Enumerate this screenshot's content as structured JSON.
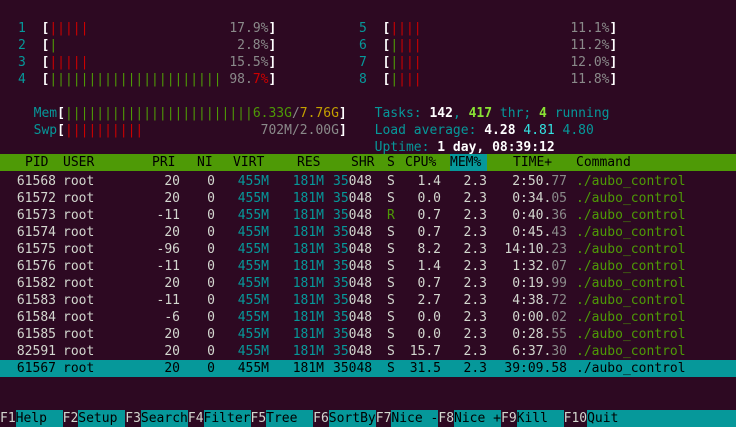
{
  "cpus": [
    {
      "num": "1",
      "bars_green": "",
      "bars_red": "|||||",
      "pct": "17.9%"
    },
    {
      "num": "2",
      "bars_green": "|",
      "bars_red": "",
      "pct": "2.8%"
    },
    {
      "num": "3",
      "bars_green": "",
      "bars_red": "|||||",
      "pct": "15.5%"
    },
    {
      "num": "4",
      "bars_green": "||||||||||||||||||||||",
      "bars_red": "",
      "pct_lead": "98.",
      "pct_tail": "7%"
    },
    {
      "num": "5",
      "bars_green": "",
      "bars_red": "||||",
      "pct": "11.1%"
    },
    {
      "num": "6",
      "bars_green": "|",
      "bars_red": "|||",
      "pct": "11.2%"
    },
    {
      "num": "7",
      "bars_green": "|",
      "bars_red": "|||",
      "pct": "12.0%"
    },
    {
      "num": "8",
      "bars_green": "|",
      "bars_red": "|||",
      "pct": "11.8%"
    }
  ],
  "mem": {
    "label": "Mem",
    "bars": "||||||||||||||||||||||||",
    "used": "6.33G",
    "sep": "/",
    "total": "7.76G"
  },
  "swp": {
    "label": "Swp",
    "bars": "||||||||||",
    "value": "702M/2.00G"
  },
  "tasks": {
    "label": "Tasks: ",
    "count": "142",
    "sep1": ", ",
    "thr": "417",
    "thr_label": " thr; ",
    "running": "4",
    "running_label": " running"
  },
  "load": {
    "label": "Load average: ",
    "l1": "4.28",
    "l5": "4.81",
    "l15": "4.80"
  },
  "uptime": {
    "label": "Uptime: ",
    "value": "1 day, 08:39:12"
  },
  "columns": {
    "pid": "PID",
    "user": "USER",
    "pri": "PRI",
    "ni": "NI",
    "virt": "VIRT",
    "res": "RES",
    "shr": "SHR",
    "s": "S",
    "cpu": "CPU%",
    "mem": "MEM%",
    "time": "TIME+",
    "command": "Command"
  },
  "processes": [
    {
      "pid": "61568",
      "user": "root",
      "pri": "20",
      "ni": "0",
      "virt": "455M",
      "res": "181M",
      "shr_a": "35",
      "shr_b": "048",
      "s": "S",
      "cpu": "1.4",
      "mem": "2.3",
      "time_a": "2:50.",
      "time_b": "77",
      "command": "./aubo_control"
    },
    {
      "pid": "61572",
      "user": "root",
      "pri": "20",
      "ni": "0",
      "virt": "455M",
      "res": "181M",
      "shr_a": "35",
      "shr_b": "048",
      "s": "S",
      "cpu": "0.0",
      "mem": "2.3",
      "time_a": "0:34.",
      "time_b": "05",
      "command": "./aubo_control"
    },
    {
      "pid": "61573",
      "user": "root",
      "pri": "-11",
      "ni": "0",
      "virt": "455M",
      "res": "181M",
      "shr_a": "35",
      "shr_b": "048",
      "s": "R",
      "cpu": "0.7",
      "mem": "2.3",
      "time_a": "0:40.",
      "time_b": "36",
      "command": "./aubo_control"
    },
    {
      "pid": "61574",
      "user": "root",
      "pri": "20",
      "ni": "0",
      "virt": "455M",
      "res": "181M",
      "shr_a": "35",
      "shr_b": "048",
      "s": "S",
      "cpu": "0.7",
      "mem": "2.3",
      "time_a": "0:45.",
      "time_b": "43",
      "command": "./aubo_control"
    },
    {
      "pid": "61575",
      "user": "root",
      "pri": "-96",
      "ni": "0",
      "virt": "455M",
      "res": "181M",
      "shr_a": "35",
      "shr_b": "048",
      "s": "S",
      "cpu": "8.2",
      "mem": "2.3",
      "time_a": "14:10.",
      "time_b": "23",
      "command": "./aubo_control"
    },
    {
      "pid": "61576",
      "user": "root",
      "pri": "-11",
      "ni": "0",
      "virt": "455M",
      "res": "181M",
      "shr_a": "35",
      "shr_b": "048",
      "s": "S",
      "cpu": "1.4",
      "mem": "2.3",
      "time_a": "1:32.",
      "time_b": "07",
      "command": "./aubo_control"
    },
    {
      "pid": "61582",
      "user": "root",
      "pri": "20",
      "ni": "0",
      "virt": "455M",
      "res": "181M",
      "shr_a": "35",
      "shr_b": "048",
      "s": "S",
      "cpu": "0.7",
      "mem": "2.3",
      "time_a": "0:19.",
      "time_b": "99",
      "command": "./aubo_control"
    },
    {
      "pid": "61583",
      "user": "root",
      "pri": "-11",
      "ni": "0",
      "virt": "455M",
      "res": "181M",
      "shr_a": "35",
      "shr_b": "048",
      "s": "S",
      "cpu": "2.7",
      "mem": "2.3",
      "time_a": "4:38.",
      "time_b": "72",
      "command": "./aubo_control"
    },
    {
      "pid": "61584",
      "user": "root",
      "pri": "-6",
      "ni": "0",
      "virt": "455M",
      "res": "181M",
      "shr_a": "35",
      "shr_b": "048",
      "s": "S",
      "cpu": "0.0",
      "mem": "2.3",
      "time_a": "0:00.",
      "time_b": "02",
      "command": "./aubo_control"
    },
    {
      "pid": "61585",
      "user": "root",
      "pri": "20",
      "ni": "0",
      "virt": "455M",
      "res": "181M",
      "shr_a": "35",
      "shr_b": "048",
      "s": "S",
      "cpu": "0.0",
      "mem": "2.3",
      "time_a": "0:28.",
      "time_b": "55",
      "command": "./aubo_control"
    },
    {
      "pid": "82591",
      "user": "root",
      "pri": "20",
      "ni": "0",
      "virt": "455M",
      "res": "181M",
      "shr_a": "35",
      "shr_b": "048",
      "s": "S",
      "cpu": "15.7",
      "mem": "2.3",
      "time_a": "6:37.",
      "time_b": "30",
      "command": "./aubo_control"
    },
    {
      "pid": "61567",
      "user": "root",
      "pri": "20",
      "ni": "0",
      "virt": "455M",
      "res": "181M",
      "shr_a": "35",
      "shr_b": "048",
      "s": "S",
      "cpu": "31.5",
      "mem": "2.3",
      "time_a": "39:09.",
      "time_b": "58",
      "command": "./aubo_control",
      "selected": true
    }
  ],
  "footer": [
    {
      "key": "F1",
      "label": "Help  "
    },
    {
      "key": "F2",
      "label": "Setup "
    },
    {
      "key": "F3",
      "label": "Search"
    },
    {
      "key": "F4",
      "label": "Filter"
    },
    {
      "key": "F5",
      "label": "Tree  "
    },
    {
      "key": "F6",
      "label": "SortBy"
    },
    {
      "key": "F7",
      "label": "Nice -"
    },
    {
      "key": "F8",
      "label": "Nice +"
    },
    {
      "key": "F9",
      "label": "Kill  "
    },
    {
      "key": "F10",
      "label": "Quit"
    }
  ],
  "colors": {
    "background": "#2d0922",
    "header_green": "#4e9a06",
    "selection_cyan": "#06989a"
  }
}
